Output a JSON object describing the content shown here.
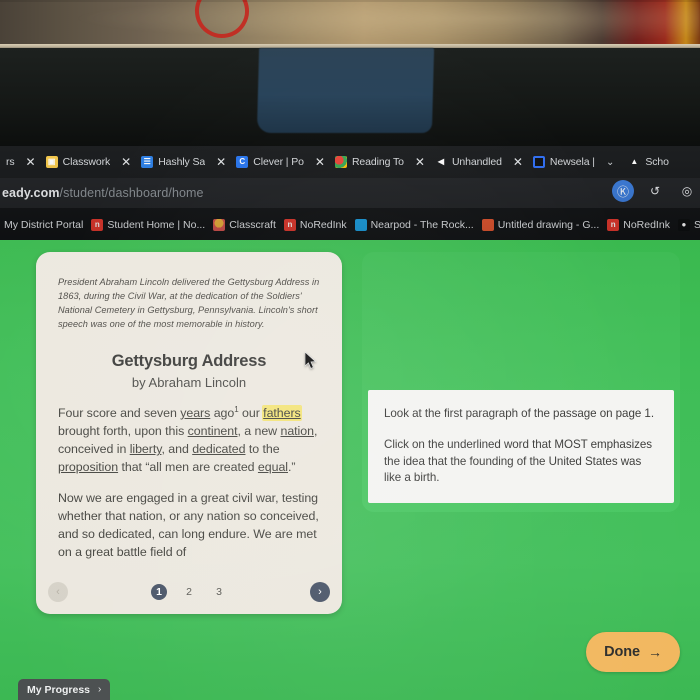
{
  "browser": {
    "tabs": [
      {
        "label": "rs",
        "favicon": "fv-none",
        "closable": true
      },
      {
        "label": "Classwork",
        "favicon": "fv-classroom",
        "closable": true
      },
      {
        "label": "Hashly Sa",
        "favicon": "fv-hashly",
        "closable": true
      },
      {
        "label": "Clever | Po",
        "favicon": "fv-clever",
        "closable": true
      },
      {
        "label": "Reading To",
        "favicon": "fv-reading",
        "closable": true
      },
      {
        "label": "Unhandled",
        "favicon": "fv-unhandled",
        "closable": true
      },
      {
        "label": "Newsela |",
        "favicon": "fv-newsela",
        "closable": false
      },
      {
        "label": "Scho",
        "favicon": "fv-school",
        "closable": false
      }
    ],
    "tab_close_glyph": "✕",
    "tab_chevron_glyph": "⌄",
    "url": {
      "host": "eady.com",
      "path": "/student/dashboard/home"
    },
    "url_actions": [
      {
        "name": "profile-avatar-icon",
        "glyph": "Ⓚ",
        "style": "blue"
      },
      {
        "name": "refresh-icon",
        "glyph": "↺",
        "style": "plain"
      },
      {
        "name": "extensions-icon",
        "glyph": "◎",
        "style": "plain"
      }
    ],
    "bookmarks": [
      {
        "label": "My District Portal",
        "icon": "ic-none",
        "icon_char": ""
      },
      {
        "label": "Student Home | No...",
        "icon": "ic-nored",
        "icon_char": "n"
      },
      {
        "label": "Classcraft",
        "icon": "ic-classcraft",
        "icon_char": ""
      },
      {
        "label": "NoRedInk",
        "icon": "ic-nored",
        "icon_char": "n"
      },
      {
        "label": "Nearpod - The Rock...",
        "icon": "ic-nearpod",
        "icon_char": ""
      },
      {
        "label": "Untitled drawing - G...",
        "icon": "ic-drawing",
        "icon_char": ""
      },
      {
        "label": "NoRedInk",
        "icon": "ic-nored",
        "icon_char": "n"
      },
      {
        "label": "SM",
        "icon": "ic-smore",
        "icon_char": "●"
      }
    ]
  },
  "passage": {
    "intro": "President Abraham Lincoln delivered the Gettysburg Address in 1863, during the Civil War, at the dedication of the Soldiers' National Cemetery in Gettysburg, Pennsylvania. Lincoln's short speech was one of the most memorable in history.",
    "title": "Gettysburg Address",
    "author": "by Abraham Lincoln",
    "paragraph1_parts": [
      {
        "t": "Four score and seven ",
        "style": "plain"
      },
      {
        "t": "years",
        "style": "underline"
      },
      {
        "t": " ago",
        "style": "plain"
      },
      {
        "t": "1",
        "style": "sup"
      },
      {
        "t": " our ",
        "style": "plain"
      },
      {
        "t": "fathers",
        "style": "selected"
      },
      {
        "t": " brought forth, upon this ",
        "style": "plain"
      },
      {
        "t": "continent",
        "style": "underline"
      },
      {
        "t": ", a new ",
        "style": "plain"
      },
      {
        "t": "nation",
        "style": "underline"
      },
      {
        "t": ", conceived in ",
        "style": "plain"
      },
      {
        "t": "liberty",
        "style": "underline"
      },
      {
        "t": ", and ",
        "style": "plain"
      },
      {
        "t": "dedicated",
        "style": "underline"
      },
      {
        "t": " to the ",
        "style": "plain"
      },
      {
        "t": "proposition",
        "style": "underline"
      },
      {
        "t": " that “all men are created ",
        "style": "plain"
      },
      {
        "t": "equal",
        "style": "underline"
      },
      {
        "t": ".”",
        "style": "plain"
      }
    ],
    "paragraph2": "Now we are engaged in a great civil war, testing whether that nation, or any nation so conceived, and so dedicated, can long endure. We are met on a great battle field of",
    "pagination": {
      "prev_glyph": "‹",
      "next_glyph": "›",
      "pages": [
        "1",
        "2",
        "3"
      ],
      "active_page": "1"
    }
  },
  "question": {
    "line1": "Look at the first paragraph of the passage on page 1.",
    "line2": "Click on the underlined word that MOST emphasizes the idea that the founding of the United States was like a birth."
  },
  "footer": {
    "done_label": "Done",
    "done_arrow": "→",
    "progress_label": "My Progress",
    "progress_chevron": "›"
  },
  "colors": {
    "page_green": "#3fbe57",
    "panel_green": "#46c25d",
    "passage_cream": "#ece8df",
    "question_white": "#f4f4f2",
    "done_orange": "#f2b860",
    "highlight_yellow": "#f3e479",
    "pager_active": "#4a5568"
  }
}
